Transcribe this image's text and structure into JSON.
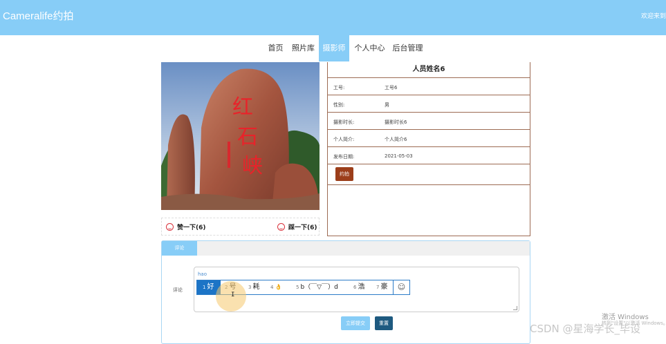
{
  "header": {
    "brand": "Cameralife约拍",
    "welcome": "欢迎来到"
  },
  "nav": {
    "items": [
      {
        "label": "首页",
        "active": false
      },
      {
        "label": "照片库",
        "active": false
      },
      {
        "label": "摄影师",
        "active": true
      },
      {
        "label": "个人中心",
        "active": false
      },
      {
        "label": "后台管理",
        "active": false
      }
    ]
  },
  "photo": {
    "inscription_chars": [
      "红",
      "石",
      "峡"
    ]
  },
  "votes": {
    "like_label": "赞一下(6)",
    "dislike_label": "踩一下(6)"
  },
  "profile": {
    "name": "人员姓名6",
    "fields": [
      {
        "key": "工号:",
        "value": "工号6"
      },
      {
        "key": "性别:",
        "value": "男"
      },
      {
        "key": "摄影时长:",
        "value": "摄影时长6"
      },
      {
        "key": "个人简介:",
        "value": "个人简介6"
      },
      {
        "key": "发布日期:",
        "value": "2021-05-03"
      }
    ],
    "book_button": "约拍"
  },
  "comments": {
    "tab_label": "评论",
    "field_label": "评论",
    "typed_text": "hao",
    "ime_candidates": [
      {
        "num": "1",
        "text": "好"
      },
      {
        "num": "2",
        "text": "号"
      },
      {
        "num": "3",
        "text": "耗"
      },
      {
        "num": "4",
        "text": "👌"
      },
      {
        "num": "5",
        "text": "b（￣▽￣）d"
      },
      {
        "num": "6",
        "text": "浩"
      },
      {
        "num": "7",
        "text": "豪"
      }
    ],
    "ime_emoji": "☺",
    "submit_label": "立即提交",
    "reset_label": "重置"
  },
  "system": {
    "activate_title": "激活 Windows",
    "activate_sub": "转到\"设置\"以激活 Windows。",
    "watermark": "CSDN @星海学长_毕设"
  },
  "colors": {
    "primary": "#87cdf7",
    "brown": "#9c6a52",
    "book_button": "#9c3e1a",
    "reset_button": "#1e5a80"
  }
}
